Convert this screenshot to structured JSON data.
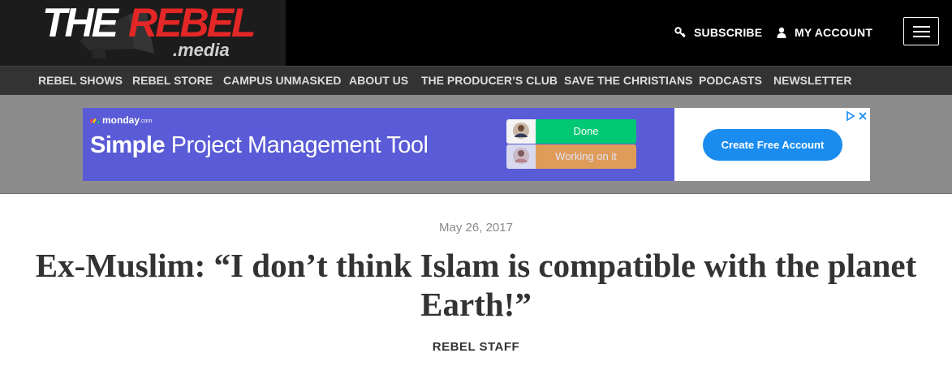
{
  "site": {
    "logo_the": "THE",
    "logo_rebel": "REBEL",
    "logo_media": ".media"
  },
  "header": {
    "subscribe_label": "SUBSCRIBE",
    "account_label": "MY ACCOUNT",
    "icons": {
      "subscribe": "key-icon",
      "account": "user-icon",
      "menu": "hamburger-menu-icon"
    }
  },
  "nav": {
    "items": [
      "REBEL SHOWS",
      "REBEL STORE",
      "CAMPUS UNMASKED",
      "ABOUT US",
      "THE PRODUCER’S CLUB",
      "SAVE THE CHRISTIANS",
      "PODCASTS",
      "NEWSLETTER"
    ]
  },
  "ad": {
    "brand": "monday",
    "brand_suffix": ".com",
    "headline_bold": "Simple",
    "headline_rest": " Project Management Tool",
    "status_done": "Done",
    "status_working": "Working on it",
    "cta": "Create Free Account",
    "colors": {
      "background": "#5a5bd6",
      "done": "#00c875",
      "working": "#fdab3d",
      "cta": "#1a8cf0"
    }
  },
  "article": {
    "date": "May 26, 2017",
    "title": "Ex-Muslim: “I don’t think Islam is compatible with the planet Earth!”",
    "author": "REBEL STAFF"
  },
  "colors": {
    "brand_red": "#e32726",
    "header_bg": "#000000",
    "nav_bg": "#333333"
  }
}
